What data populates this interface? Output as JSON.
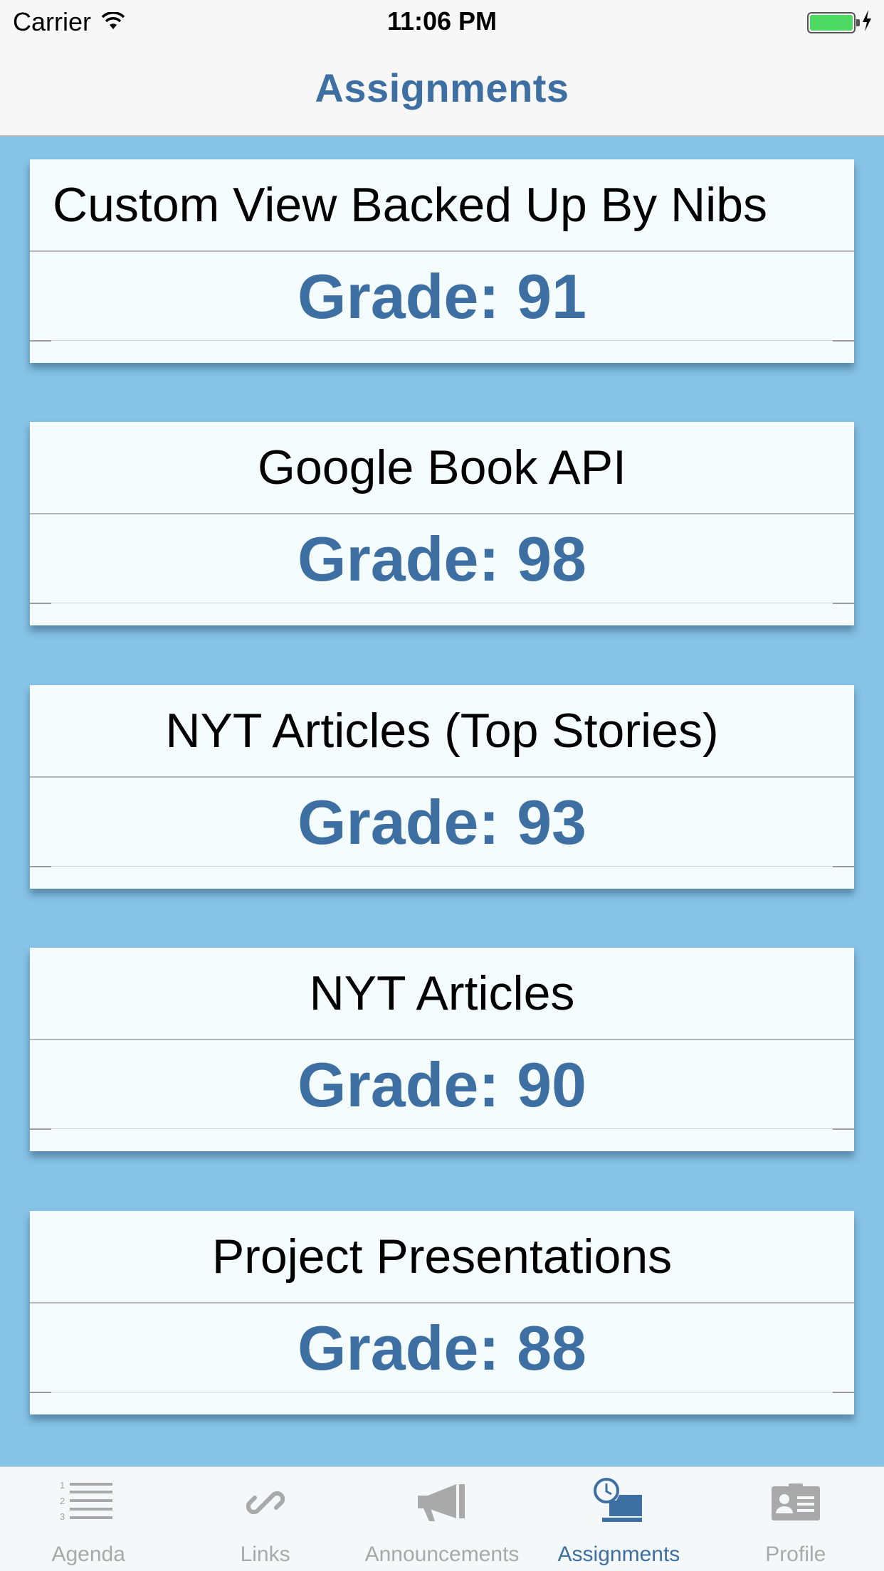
{
  "status_bar": {
    "carrier": "Carrier",
    "time": "11:06 PM",
    "battery_color": "#4cd964"
  },
  "nav": {
    "title": "Assignments"
  },
  "assignments": [
    {
      "title": "Custom View Backed Up By Nibs",
      "grade": "Grade: 91"
    },
    {
      "title": "Google Book API",
      "grade": "Grade: 98"
    },
    {
      "title": "NYT Articles (Top Stories)",
      "grade": "Grade: 93"
    },
    {
      "title": "NYT Articles",
      "grade": "Grade: 90"
    },
    {
      "title": "Project Presentations",
      "grade": "Grade: 88"
    }
  ],
  "tabs": [
    {
      "label": "Agenda",
      "icon": "list-icon",
      "active": false
    },
    {
      "label": "Links",
      "icon": "link-icon",
      "active": false
    },
    {
      "label": "Announcements",
      "icon": "megaphone-icon",
      "active": false
    },
    {
      "label": "Assignments",
      "icon": "clock-desk-icon",
      "active": true
    },
    {
      "label": "Profile",
      "icon": "id-card-icon",
      "active": false
    }
  ],
  "colors": {
    "accent": "#3e6fa3",
    "background": "#86c3e6",
    "card": "#f4fcfd",
    "inactive_tab": "#a9a9a9"
  }
}
